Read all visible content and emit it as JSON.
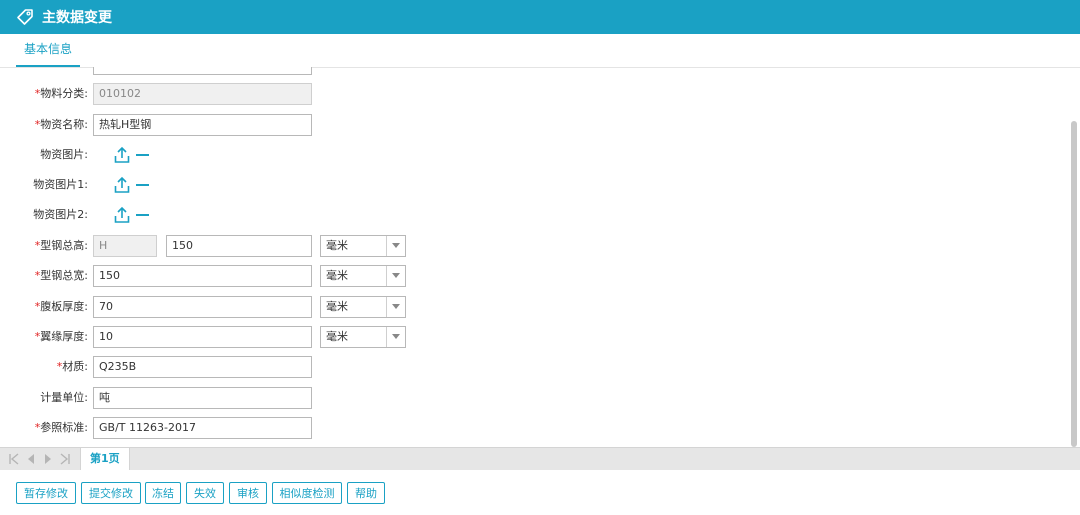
{
  "header": {
    "title": "主数据变更",
    "icon": "tag-icon"
  },
  "tabs": [
    {
      "label": "基本信息",
      "active": true
    }
  ],
  "form": {
    "req_mark": "*",
    "category": {
      "label": "物料分类:",
      "value": "010102"
    },
    "name": {
      "label": "物资名称:",
      "value": "热轧H型钢"
    },
    "image": {
      "label": "物资图片:"
    },
    "image1": {
      "label": "物资图片1:"
    },
    "image2": {
      "label": "物资图片2:"
    },
    "height": {
      "label": "型钢总高:",
      "prefix": "H",
      "value": "150",
      "unit": "毫米"
    },
    "width": {
      "label": "型钢总宽:",
      "value": "150",
      "unit": "毫米"
    },
    "web": {
      "label": "腹板厚度:",
      "value": "70",
      "unit": "毫米"
    },
    "flange": {
      "label": "翼缘厚度:",
      "value": "10",
      "unit": "毫米"
    },
    "material": {
      "label": "材质:",
      "value": "Q235B"
    },
    "uom": {
      "label": "计量单位:",
      "value": "吨"
    },
    "standard": {
      "label": "参照标准:",
      "value": "GB/T 11263-2017"
    }
  },
  "pager": {
    "page_label": "第1页"
  },
  "actions": {
    "temp_save": "暂存修改",
    "submit": "提交修改",
    "freeze": "冻结",
    "invalidate": "失效",
    "audit": "审核",
    "similarity": "相似度检测",
    "help": "帮助"
  },
  "colors": {
    "accent": "#1aa1c4",
    "required": "#e02020"
  }
}
